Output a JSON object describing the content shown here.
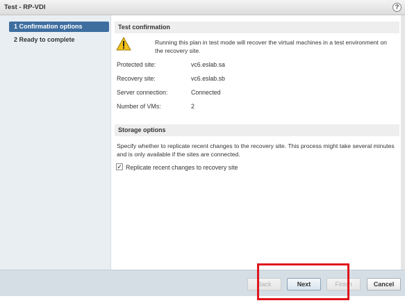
{
  "window": {
    "title": "Test - RP-VDI",
    "help_icon": "?"
  },
  "sidebar": {
    "items": [
      {
        "number": "1",
        "label": "1  Confirmation options",
        "active": true
      },
      {
        "number": "2",
        "label": "2  Ready to complete",
        "active": false
      }
    ]
  },
  "test_confirmation": {
    "header": "Test confirmation",
    "warning_text": "Running this plan in test mode will recover the virtual machines in a test environment on the recovery site.",
    "rows": [
      {
        "label": "Protected site:",
        "value": "vc6.eslab.sa"
      },
      {
        "label": "Recovery site:",
        "value": "vc6.eslab.sb"
      },
      {
        "label": "Server connection:",
        "value": "Connected"
      },
      {
        "label": "Number of VMs:",
        "value": "2"
      }
    ]
  },
  "storage_options": {
    "header": "Storage options",
    "description": "Specify whether to replicate recent changes to the recovery site. This process might take several minutes and is only available if the sites are connected.",
    "checkbox_label": "Replicate recent changes to recovery site",
    "checkbox_checked": true,
    "checkmark": "✓"
  },
  "footer": {
    "back_label": "Back",
    "next_label": "Next",
    "finish_label": "Finish",
    "cancel_label": "Cancel"
  },
  "colors": {
    "active_step": "#3e6e9f",
    "highlight_box": "#e0141d",
    "warning_icon": "#f2c21a"
  }
}
